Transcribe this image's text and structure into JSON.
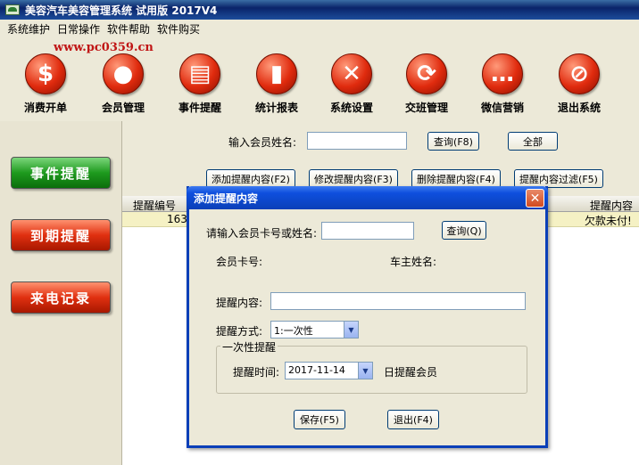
{
  "window": {
    "title": "美容汽车美容管理系统 试用版  2017V4"
  },
  "menu": [
    "系统维护",
    "日常操作",
    "软件帮助",
    "软件购买"
  ],
  "watermark": "www.pc0359.cn",
  "toolbar": [
    {
      "label": "消费开单",
      "icon": "dollar-icon",
      "glyph": "$"
    },
    {
      "label": "会员管理",
      "icon": "person-icon",
      "glyph": "●"
    },
    {
      "label": "事件提醒",
      "icon": "notebook-icon",
      "glyph": "▤"
    },
    {
      "label": "统计报表",
      "icon": "bar-chart-icon",
      "glyph": "▮"
    },
    {
      "label": "系统设置",
      "icon": "tools-icon",
      "glyph": "✕"
    },
    {
      "label": "交班管理",
      "icon": "refresh-icon",
      "glyph": "⟳"
    },
    {
      "label": "微信营销",
      "icon": "chat-icon",
      "glyph": "…"
    },
    {
      "label": "退出系统",
      "icon": "stop-icon",
      "glyph": "⊘"
    }
  ],
  "leftnav": [
    "事件提醒",
    "到期提醒",
    "来电记录"
  ],
  "search": {
    "label": "输入会员姓名:",
    "value": "",
    "query_btn": "查询(F8)",
    "all_btn": "全部"
  },
  "actions": [
    "添加提醒内容(F2)",
    "修改提醒内容(F3)",
    "删除提醒内容(F4)",
    "提醒内容过滤(F5)"
  ],
  "grid": {
    "headers": [
      "提醒编号",
      "提醒内容"
    ],
    "rows": [
      {
        "id": "163",
        "content": "欠款未付!"
      }
    ]
  },
  "dialog": {
    "title": "添加提醒内容",
    "card_label": "请输入会员卡号或姓名:",
    "card_value": "",
    "query_btn": "查询(Q)",
    "member_no_label": "会员卡号:",
    "owner_label": "车主姓名:",
    "content_label": "提醒内容:",
    "content_value": "",
    "mode_label": "提醒方式:",
    "mode_value": "1:一次性",
    "group_label": "一次性提醒",
    "time_label": "提醒时间:",
    "time_value": "2017-11-14",
    "time_suffix": "日提醒会员",
    "save_btn": "保存(F5)",
    "exit_btn": "退出(F4)"
  }
}
